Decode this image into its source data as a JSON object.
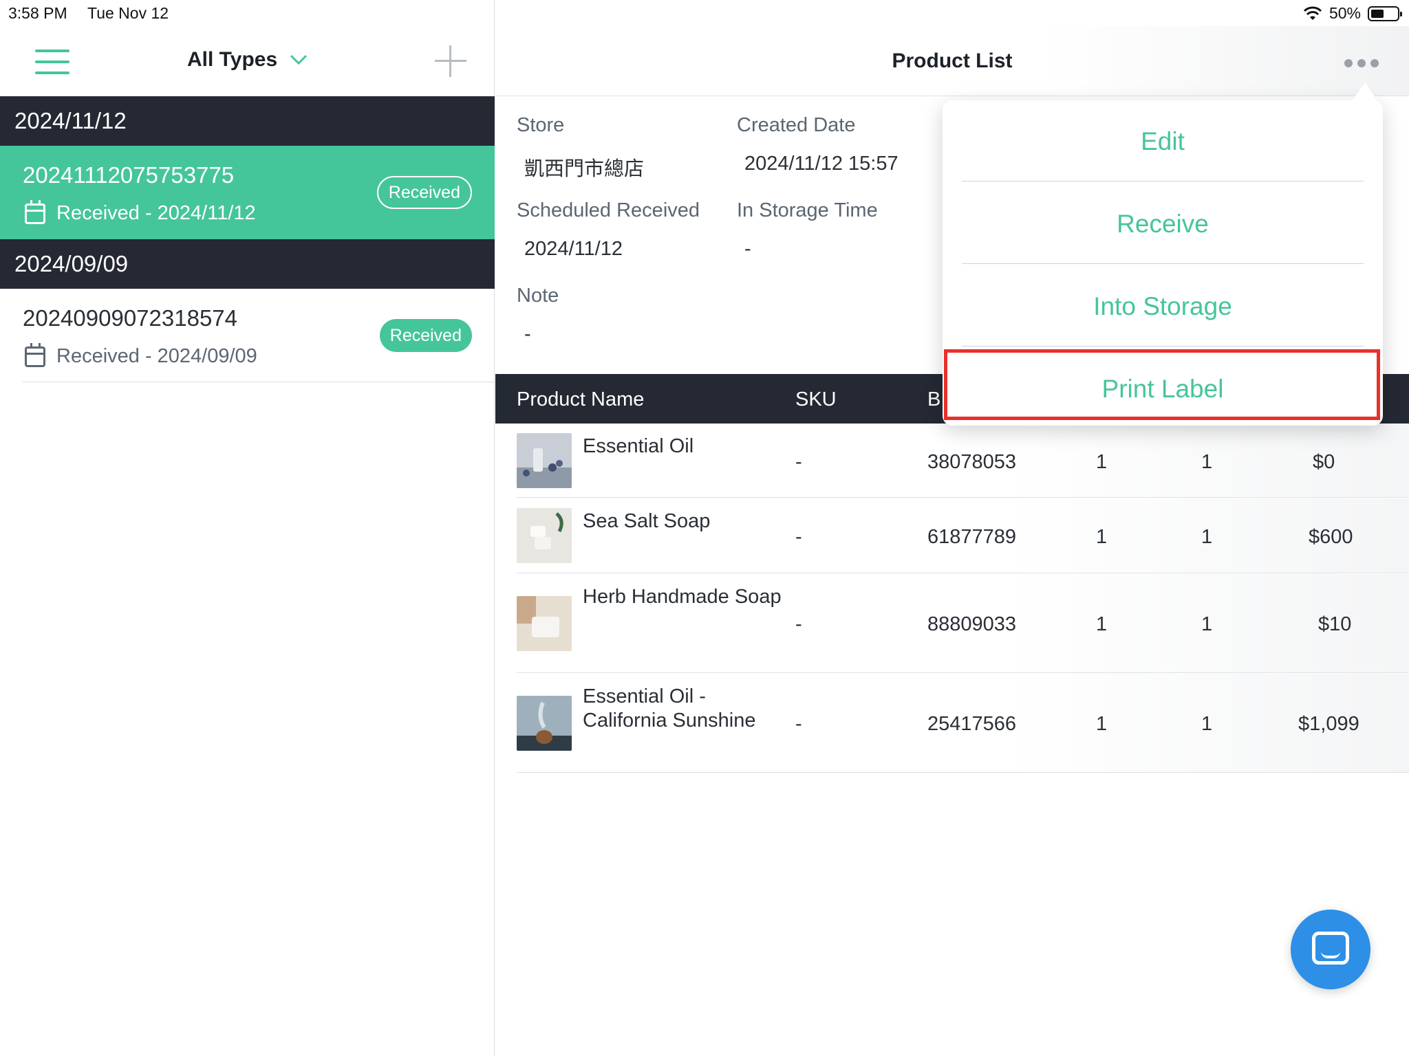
{
  "status_bar": {
    "time": "3:58 PM",
    "date": "Tue Nov 12",
    "battery": "50%"
  },
  "left": {
    "filter_label": "All Types",
    "groups": [
      {
        "date": "2024/11/12",
        "order_id": "20241112075753775",
        "status_text": "Received - 2024/11/12",
        "badge": "Received"
      },
      {
        "date": "2024/09/09",
        "order_id": "20240909072318574",
        "status_text": "Received - 2024/09/09",
        "badge": "Received"
      }
    ]
  },
  "right": {
    "title": "Product List",
    "info": {
      "store_label": "Store",
      "store_value": "凱西門市總店",
      "created_label": "Created Date",
      "created_value": "2024/11/12 15:57",
      "scheduled_label": "Scheduled Received",
      "scheduled_value": "2024/11/12",
      "storage_label": "In Storage Time",
      "storage_value": "-",
      "note_label": "Note",
      "note_value": "-"
    },
    "table": {
      "headers": [
        "Product Name",
        "SKU",
        "B"
      ],
      "rows": [
        {
          "name": "Essential Oil",
          "sku": "-",
          "barcode": "38078053",
          "qty1": "1",
          "qty2": "1",
          "price": "$0"
        },
        {
          "name": "Sea Salt Soap",
          "sku": "-",
          "barcode": "61877789",
          "qty1": "1",
          "qty2": "1",
          "price": "$600"
        },
        {
          "name": "Herb Handmade Soap",
          "sku": "-",
          "barcode": "88809033",
          "qty1": "1",
          "qty2": "1",
          "price": "$10"
        },
        {
          "name": "Essential Oil - California Sunshine",
          "sku": "-",
          "barcode": "25417566",
          "qty1": "1",
          "qty2": "1",
          "price": "$1,099"
        }
      ]
    }
  },
  "menu": {
    "items": [
      "Edit",
      "Receive",
      "Into Storage",
      "Print Label"
    ]
  },
  "colors": {
    "accent": "#45c59a",
    "dark_header": "#242933",
    "highlight": "#e8312a",
    "chat": "#2d8fe6"
  },
  "icons": {
    "menu": "hamburger-icon",
    "filter": "chevron-down-icon",
    "add": "plus-icon",
    "more": "more-horizontal-icon",
    "calendar": "calendar-icon",
    "chat": "chat-icon"
  }
}
